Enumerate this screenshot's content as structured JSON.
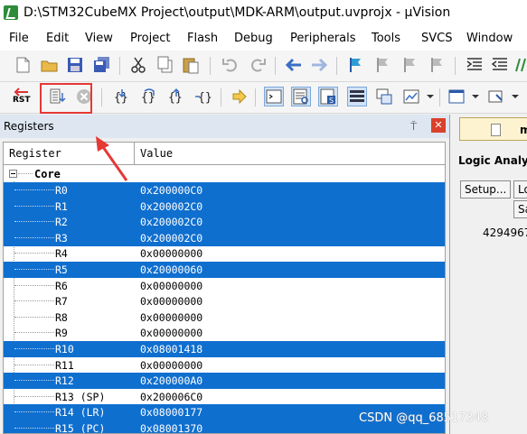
{
  "window": {
    "title": "D:\\STM32CubeMX Project\\output\\MDK-ARM\\output.uvprojx - µVision"
  },
  "menu": [
    "File",
    "Edit",
    "View",
    "Project",
    "Flash",
    "Debug",
    "Peripherals",
    "Tools",
    "SVCS",
    "Window"
  ],
  "toolbar_debug": {
    "reset_label": "RST"
  },
  "registers_panel": {
    "title": "Registers",
    "col_register": "Register",
    "col_value": "Value",
    "group": "Core",
    "rows": [
      {
        "name": "R0",
        "value": "0x200000C0",
        "selected": true
      },
      {
        "name": "R1",
        "value": "0x200002C0",
        "selected": true
      },
      {
        "name": "R2",
        "value": "0x200002C0",
        "selected": true
      },
      {
        "name": "R3",
        "value": "0x200002C0",
        "selected": true
      },
      {
        "name": "R4",
        "value": "0x00000000",
        "selected": false
      },
      {
        "name": "R5",
        "value": "0x20000060",
        "selected": true
      },
      {
        "name": "R6",
        "value": "0x00000000",
        "selected": false
      },
      {
        "name": "R7",
        "value": "0x00000000",
        "selected": false
      },
      {
        "name": "R8",
        "value": "0x00000000",
        "selected": false
      },
      {
        "name": "R9",
        "value": "0x00000000",
        "selected": false
      },
      {
        "name": "R10",
        "value": "0x08001418",
        "selected": true
      },
      {
        "name": "R11",
        "value": "0x00000000",
        "selected": false
      },
      {
        "name": "R12",
        "value": "0x200000A0",
        "selected": true
      },
      {
        "name": "R13 (SP)",
        "value": "0x200006C0",
        "selected": false
      },
      {
        "name": "R14 (LR)",
        "value": "0x08000177",
        "selected": true
      },
      {
        "name": "R15 (PC)",
        "value": "0x08001370",
        "selected": true
      }
    ]
  },
  "right_panel": {
    "tab_label": "ma",
    "title": "Logic Analy",
    "setup_button": "Setup...",
    "lo_button": "Lo",
    "sa_button": "Sa",
    "value": "4294967"
  },
  "watermark": "CSDN @qq_68517348",
  "colors": {
    "selection": "#0f6fcf",
    "highlight_box": "#e53935",
    "panel_header": "#dde6f1"
  }
}
